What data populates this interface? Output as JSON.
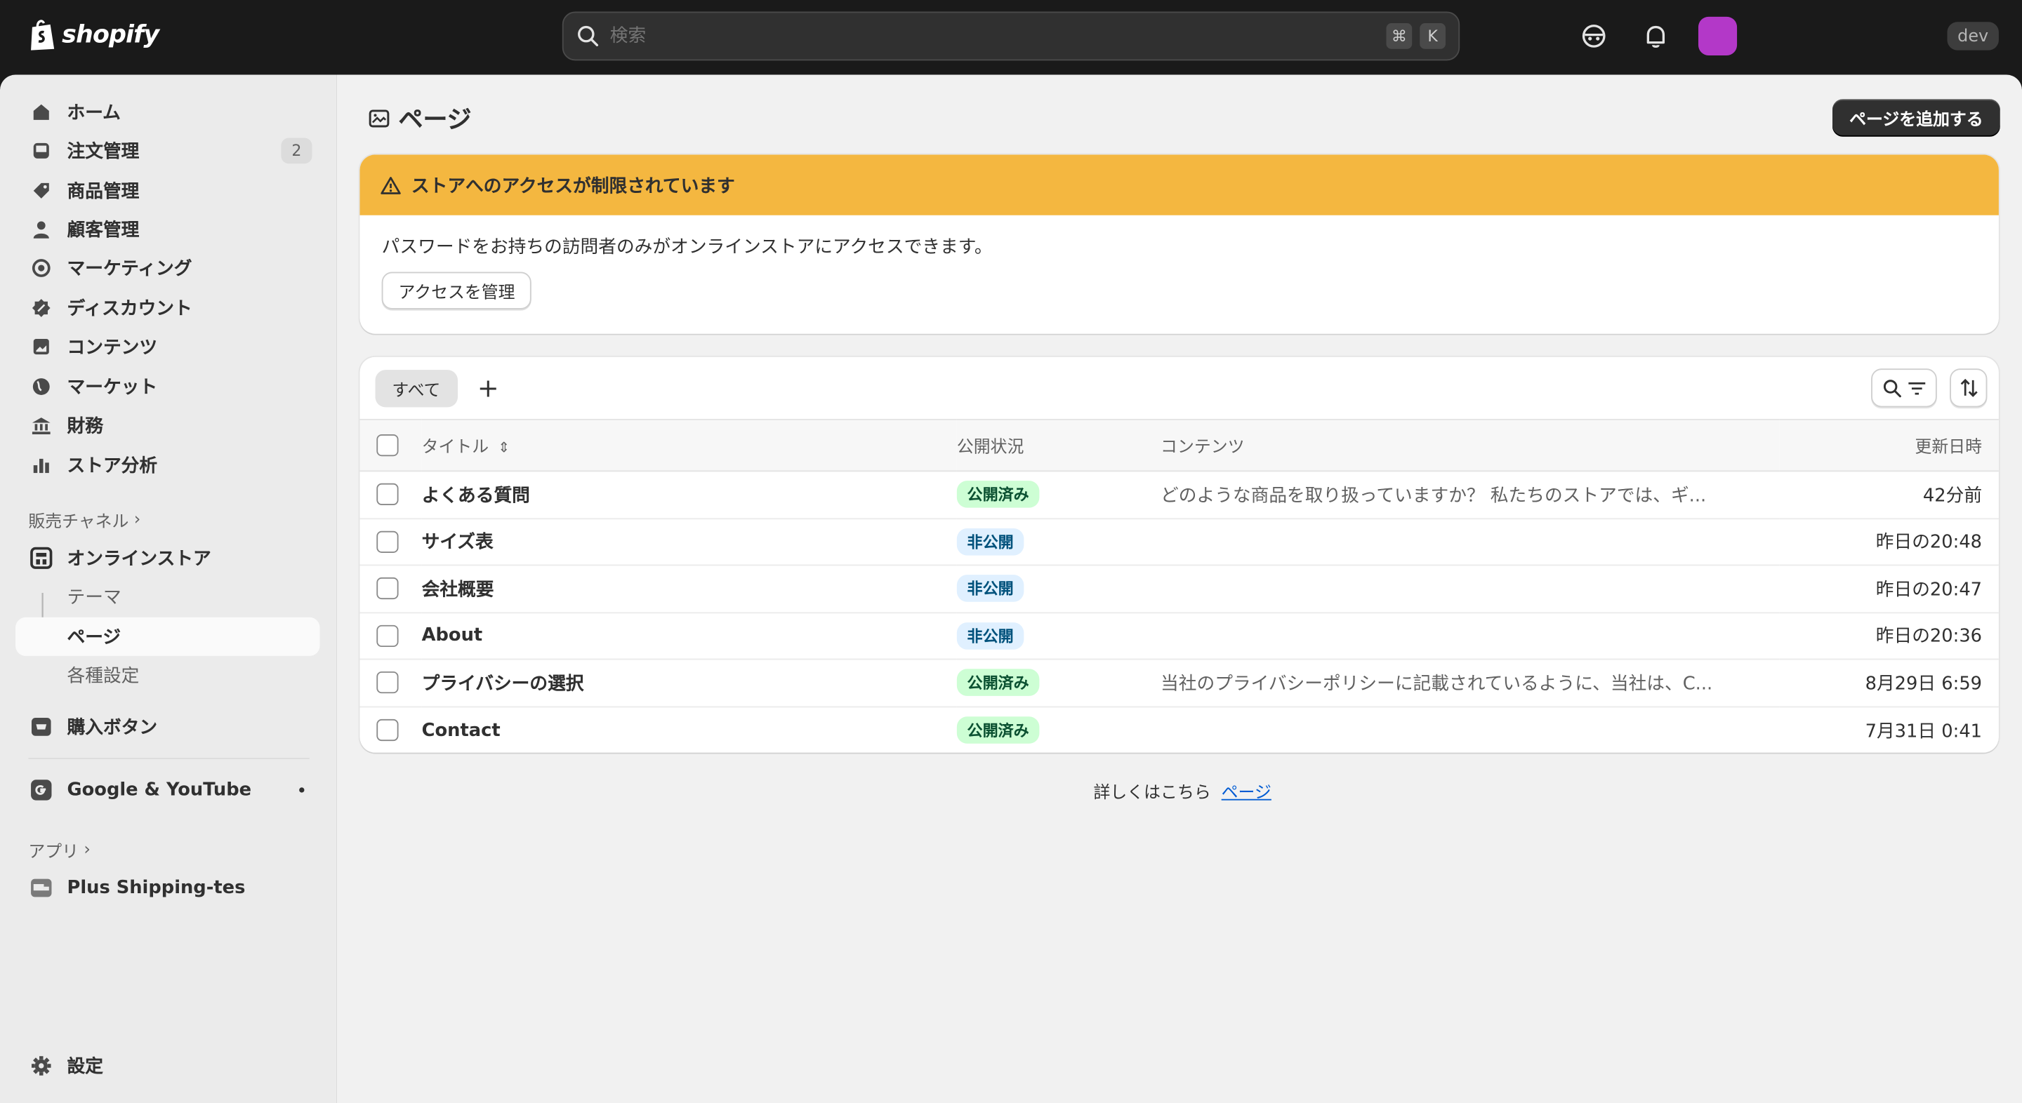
{
  "topbar": {
    "logo_text": "shopify",
    "search_placeholder": "検索",
    "shortcut_cmd": "⌘",
    "shortcut_key": "K",
    "store_badge": "dev",
    "avatar_color": "#b338c8"
  },
  "sidebar": {
    "items": [
      {
        "label": "ホーム",
        "icon": "home-icon"
      },
      {
        "label": "注文管理",
        "icon": "inbox-icon",
        "badge": "2"
      },
      {
        "label": "商品管理",
        "icon": "tag-icon"
      },
      {
        "label": "顧客管理",
        "icon": "person-icon"
      },
      {
        "label": "マーケティング",
        "icon": "target-icon"
      },
      {
        "label": "ディスカウント",
        "icon": "discount-icon"
      },
      {
        "label": "コンテンツ",
        "icon": "image-icon"
      },
      {
        "label": "マーケット",
        "icon": "globe-icon"
      },
      {
        "label": "財務",
        "icon": "bank-icon"
      },
      {
        "label": "ストア分析",
        "icon": "chart-icon"
      }
    ],
    "sales_channels_label": "販売チャネル",
    "online_store": "オンラインストア",
    "sub_items": [
      "テーマ",
      "ページ",
      "各種設定"
    ],
    "buy_button": "購入ボタン",
    "google_youtube": "Google & YouTube",
    "apps_label": "アプリ",
    "app_item": "Plus Shipping-tes",
    "settings": "設定"
  },
  "page": {
    "title": "ページ",
    "add_button": "ページを追加する"
  },
  "banner": {
    "title": "ストアへのアクセスが制限されています",
    "body": "パスワードをお持ちの訪問者のみがオンラインストアにアクセスできます。",
    "button": "アクセスを管理",
    "color": "#f4b740"
  },
  "table": {
    "tab_all": "すべて",
    "tab_add": "+",
    "headers": {
      "title": "タイトル",
      "status": "公開状況",
      "content": "コンテンツ",
      "updated": "更新日時"
    },
    "rows": [
      {
        "title": "よくある質問",
        "status": "公開済み",
        "status_type": "published",
        "content": "どのような商品を取り扱っていますか？ 私たちのストアでは、ギ...",
        "updated": "42分前"
      },
      {
        "title": "サイズ表",
        "status": "非公開",
        "status_type": "hidden",
        "content": "",
        "updated": "昨日の20:48"
      },
      {
        "title": "会社概要",
        "status": "非公開",
        "status_type": "hidden",
        "content": "",
        "updated": "昨日の20:47"
      },
      {
        "title": "About",
        "status": "非公開",
        "status_type": "hidden",
        "content": "",
        "updated": "昨日の20:36"
      },
      {
        "title": "プライバシーの選択",
        "status": "公開済み",
        "status_type": "published",
        "content": "当社のプライバシーポリシーに記載されているように、当社は、C...",
        "updated": "8月29日 6:59"
      },
      {
        "title": "Contact",
        "status": "公開済み",
        "status_type": "published",
        "content": "",
        "updated": "7月31日 0:41"
      }
    ]
  },
  "footer": {
    "text": "詳しくはこちら",
    "link": "ページ"
  }
}
